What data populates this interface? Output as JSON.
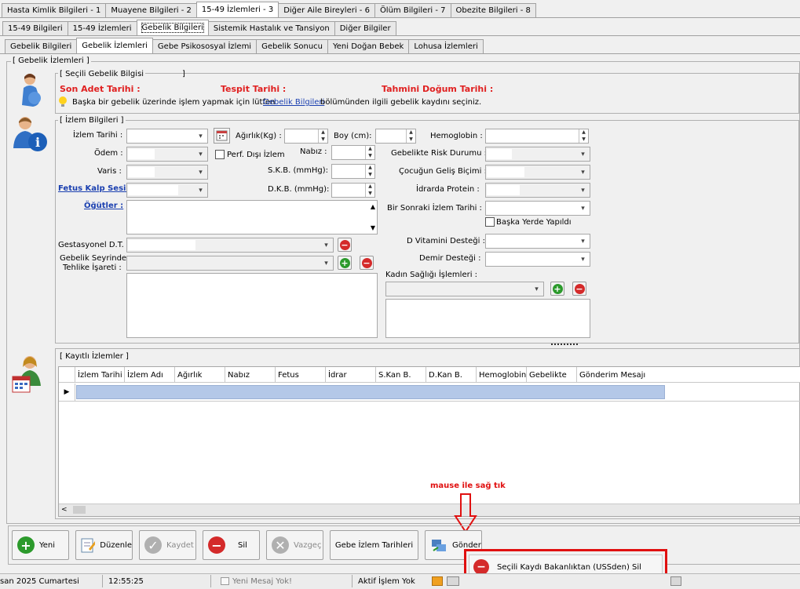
{
  "main_tabs": [
    "Hasta Kimlik Bilgileri - 1",
    "Muayene Bilgileri - 2",
    "15-49 İzlemleri - 3",
    "Diğer Aile Bireyleri - 6",
    "Ölüm Bilgileri - 7",
    "Obezite Bilgileri - 8"
  ],
  "sub_tabs": [
    "15-49 Bilgileri",
    "15-49 İzlemleri",
    "Gebelik Bilgileri",
    "Sistemik Hastalık ve Tansiyon",
    "Diğer Bilgiler"
  ],
  "inner_tabs": [
    "Gebelik Bilgileri",
    "Gebelik İzlemleri",
    "Gebe Psikososyal İzlemi",
    "Gebelik Sonucu",
    "Yeni Doğan Bebek",
    "Lohusa İzlemleri"
  ],
  "outer_group": "[ Gebelik İzlemleri ]",
  "selected_group": {
    "title": "[ Seçili Gebelik Bilgisi",
    "close": "]",
    "son_adet": "Son Adet Tarihi :",
    "tespit": "Tespit Tarihi :",
    "tahmini": "Tahmini Doğum Tarihi :",
    "info_pre": "Başka bir gebelik üzerinde işlem yapmak için lütfen",
    "info_link": "Gebelik Bilgileri",
    "info_post": "bölümünden ilgili gebelik kaydını seçiniz."
  },
  "izlem_group": {
    "title": "[ İzlem Bilgileri ]",
    "izlem_tarihi": "İzlem Tarihi :",
    "odem": "Ödem :",
    "varis": "Varis :",
    "fetus_kalp": "Fetus Kalp Sesi :",
    "ogutler": "Öğütler :",
    "agirlik": "Ağırlık(Kg) :",
    "perf": "Perf. Dışı İzlem",
    "nabiz": "Nabız :",
    "skb": "S.K.B. (mmHg):",
    "dkb": "D.K.B. (mmHg):",
    "boy": "Boy (cm):",
    "hemoglobin": "Hemoglobin :",
    "risk": "Gebelikte Risk Durumu :",
    "cocuk": "Çocuğun Geliş Biçimi :",
    "idrar": "İdrarda Protein :",
    "sonraki": "Bir Sonraki İzlem Tarihi :",
    "baska_yer": "Başka Yerde Yapıldı",
    "dvit": "D Vitamini Desteği :",
    "demir": "Demir  Desteği :",
    "kadin": "Kadın Sağlığı İşlemleri :",
    "gestasyonel": "Gestasyonel D.T.",
    "tehlike1": "Gebelik Seyrinde",
    "tehlike2": "Tehlike İşareti :"
  },
  "kayitli_group": {
    "title": "[ Kayıtlı İzlemler ]",
    "columns": [
      "İzlem Tarihi",
      "İzlem Adı",
      "Ağırlık",
      "Nabız",
      "Fetus",
      "İdrar",
      "S.Kan B.",
      "D.Kan B.",
      "Hemoglobin",
      "Gebelikte",
      "Gönderim Mesajı"
    ]
  },
  "annotation": "mause ile sağ tık",
  "buttons": {
    "yeni": "Yeni",
    "duzenle": "Düzenle",
    "kaydet": "Kaydet",
    "sil": "Sil",
    "vazgec": "Vazgeç",
    "gebe_izlem": "Gebe İzlem Tarihleri",
    "gonder": "Gönder"
  },
  "context_menu": {
    "item": "Seçili Kaydı Bakanlıktan (USSden) Sil"
  },
  "status": {
    "date": "san 2025 Cumartesi",
    "time": "12:55:25",
    "mesaj": "Yeni Mesaj Yok!",
    "islem": "Aktif İşlem Yok"
  },
  "colors": {
    "required_red": "#e02020",
    "link_blue": "#1a3fb0",
    "highlight_red": "#e01010",
    "selected_row": "#b4c8e8"
  }
}
